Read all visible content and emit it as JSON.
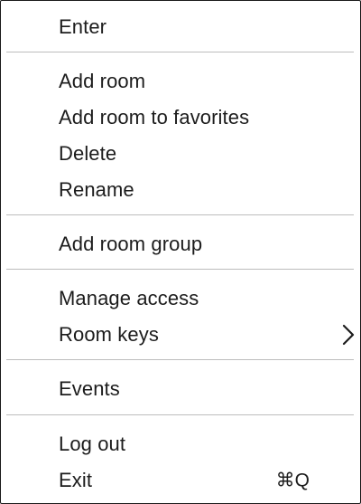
{
  "menu": {
    "items": [
      {
        "label": "Enter"
      },
      {
        "label": "Add room"
      },
      {
        "label": "Add room to favorites"
      },
      {
        "label": "Delete"
      },
      {
        "label": "Rename"
      },
      {
        "label": "Add room group"
      },
      {
        "label": "Manage access"
      },
      {
        "label": "Room keys",
        "submenu_icon": "chevron-right-icon"
      },
      {
        "label": "Events"
      },
      {
        "label": "Log out"
      },
      {
        "label": "Exit",
        "shortcut": "⌘Q"
      }
    ]
  }
}
